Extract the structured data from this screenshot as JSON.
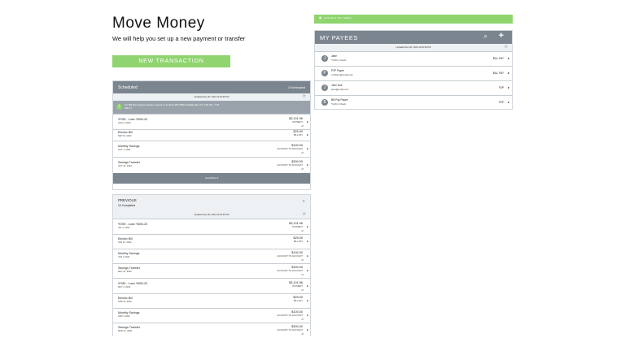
{
  "hero": {
    "title": "Move Money",
    "subtitle": "We will help you set up a new payment or transfer",
    "new_transaction": "NEW TRANSACTION"
  },
  "payees_banner": {
    "icon": "money-icon",
    "text": "LIVE BILL PAY DEMO"
  },
  "payees": {
    "title": "MY PAYEES",
    "updated": "Updated Sep 30, 2024 12:52:39 PM",
    "items": [
      {
        "initial": "J",
        "name": "Jane",
        "sub": "*1234 | Check",
        "type": "BILL PAY"
      },
      {
        "initial": "P",
        "name": "P2P Payee",
        "sub": "mchilton@email.com",
        "type": "BILL PAY"
      },
      {
        "initial": "J",
        "name": "John Doe",
        "sub": "jdoe@email.com",
        "type": "P2P"
      },
      {
        "initial": "B",
        "name": "Bill Pay Payee",
        "sub": "*1234 | Check",
        "type": "P2P"
      }
    ]
  },
  "scheduled": {
    "title": "Scheduled",
    "count": "4 Scheduled",
    "updated": "Updated Sep 30, 2024 12:52:39 PM",
    "alert": "For Bill Pay Support, please contact us at (123) 456-7890 Available Mon-Fri 7:00 AM - 7:00 PM CT",
    "load_more": "Load More",
    "items": [
      {
        "name": "*6789 - Loan *0500-20",
        "date": "AUG 4, 2022",
        "amount": "$3,101.96",
        "type": "PAYMENT",
        "recurring": true
      },
      {
        "name": "Electric Bill",
        "date": "SEP 10, 2022",
        "amount": "$25.00",
        "type": "BILL PAY",
        "recurring": false
      },
      {
        "name": "Monthly Savings",
        "date": "OCT 1, 2022",
        "amount": "$100.00",
        "type": "ACCOUNT TO ACCOUNT",
        "recurring": true
      },
      {
        "name": "Savings Transfer",
        "date": "OCT 31, 2022",
        "amount": "$300.00",
        "type": "ACCOUNT TO ACCOUNT",
        "recurring": true
      }
    ]
  },
  "previous": {
    "title": "PREVIOUS",
    "count": "10 Completed",
    "updated": "Updated Sep 30, 2024 12:52:39 PM",
    "items": [
      {
        "name": "*6789 - Loan *0500-20",
        "date": "JUL 4, 2022",
        "amount": "$3,101.96",
        "type": "PAYMENT",
        "recurring": true
      },
      {
        "name": "Electric Bill",
        "date": "JUN 10, 2022",
        "amount": "$25.00",
        "type": "BILL PAY",
        "recurring": false
      },
      {
        "name": "Monthly Savings",
        "date": "JUN 1 2022",
        "amount": "$100.00",
        "type": "ACCOUNT TO ACCOUNT",
        "recurring": true
      },
      {
        "name": "Savings Transfer",
        "date": "MAY 31, 2022",
        "amount": "$300.00",
        "type": "ACCOUNT TO ACCOUNT",
        "recurring": true
      },
      {
        "name": "*6789 - Loan *0500-20",
        "date": "MAY 4, 2022",
        "amount": "$3,101.96",
        "type": "PAYMENT",
        "recurring": true
      },
      {
        "name": "Electric Bill",
        "date": "APR 10, 2022",
        "amount": "$25.00",
        "type": "BILL PAY",
        "recurring": false
      },
      {
        "name": "Monthly Savings",
        "date": "APR 1 2022",
        "amount": "$100.00",
        "type": "ACCOUNT TO ACCOUNT",
        "recurring": true
      },
      {
        "name": "Savings Transfer",
        "date": "MAR 31, 2022",
        "amount": "$300.00",
        "type": "ACCOUNT TO ACCOUNT",
        "recurring": true
      }
    ]
  }
}
